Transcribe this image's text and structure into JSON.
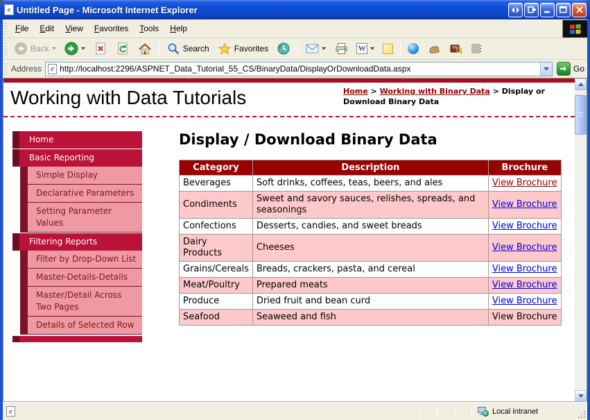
{
  "window": {
    "title": "Untitled Page - Microsoft Internet Explorer",
    "menu": [
      "File",
      "Edit",
      "View",
      "Favorites",
      "Tools",
      "Help"
    ],
    "toolbar": {
      "back_label": "Back",
      "search_label": "Search",
      "favorites_label": "Favorites"
    },
    "address": {
      "label": "Address",
      "url": "http://localhost:2296/ASPNET_Data_Tutorial_55_CS/BinaryData/DisplayOrDownloadData.aspx",
      "go_label": "Go"
    },
    "status": {
      "zone_label": "Local intranet"
    }
  },
  "page": {
    "site_title": "Working with Data Tutorials",
    "breadcrumb": {
      "home_label": "Home",
      "separator": ">",
      "section_label": "Working with Binary Data",
      "current_label": "Display or Download Binary Data"
    },
    "sidebar": {
      "items": [
        {
          "label": "Home",
          "level": 1
        },
        {
          "label": "Basic Reporting",
          "level": 1
        },
        {
          "label": "Simple Display",
          "level": 2
        },
        {
          "label": "Declarative Parameters",
          "level": 2
        },
        {
          "label": "Setting Parameter Values",
          "level": 2
        },
        {
          "label": "Filtering Reports",
          "level": 1
        },
        {
          "label": "Filter by Drop-Down List",
          "level": 2
        },
        {
          "label": "Master-Details-Details",
          "level": 2
        },
        {
          "label": "Master/Detail Across Two Pages",
          "level": 2
        },
        {
          "label": "Details of Selected Row",
          "level": 2
        }
      ]
    },
    "main": {
      "heading": "Display / Download Binary Data",
      "table": {
        "columns": [
          "Category",
          "Description",
          "Brochure"
        ],
        "rows": [
          {
            "category": "Beverages",
            "description": "Soft drinks, coffees, teas, beers, and ales",
            "brochure": "View Brochure",
            "link_state": "visited"
          },
          {
            "category": "Condiments",
            "description": "Sweet and savory sauces, relishes, spreads, and seasonings",
            "brochure": "View Brochure",
            "link_state": "link"
          },
          {
            "category": "Confections",
            "description": "Desserts, candies, and sweet breads",
            "brochure": "View Brochure",
            "link_state": "link"
          },
          {
            "category": "Dairy Products",
            "description": "Cheeses",
            "brochure": "View Brochure",
            "link_state": "link"
          },
          {
            "category": "Grains/Cereals",
            "description": "Breads, crackers, pasta, and cereal",
            "brochure": "View Brochure",
            "link_state": "link"
          },
          {
            "category": "Meat/Poultry",
            "description": "Prepared meats",
            "brochure": "View Brochure",
            "link_state": "link"
          },
          {
            "category": "Produce",
            "description": "Dried fruit and bean curd",
            "brochure": "View Brochure",
            "link_state": "link"
          },
          {
            "category": "Seafood",
            "description": "Seaweed and fish",
            "brochure": "View Brochure",
            "link_state": "none"
          }
        ]
      }
    }
  },
  "colors": {
    "titlebar_blue": "#1150d8",
    "nav_header_crimson": "#ba1239",
    "nav_sub_pink": "#ef9aa3",
    "nav_dark_maroon": "#7d1326",
    "table_header_maroon": "#990000",
    "row_pink": "#ffc9cb",
    "link_blue": "#0000e6",
    "link_maroon": "#990000",
    "top_bar_red": "#a90f23"
  }
}
